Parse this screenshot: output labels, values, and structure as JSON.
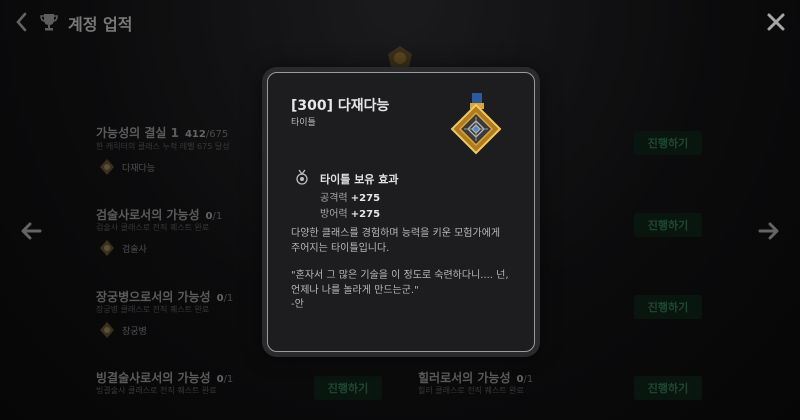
{
  "header": {
    "title": "계정 업적"
  },
  "list": [
    {
      "name": "가능성의 결실 1",
      "done": "412",
      "total": "/675",
      "desc": "한 캐릭터의 클래스 누적 레벨 675 달성",
      "reward": "다재다능",
      "action": "진행하기"
    },
    {
      "name": "검술사로서의 가능성",
      "done": "0",
      "total": "/1",
      "desc": "검술사 클래스로 전직 퀘스트 완료",
      "reward": "검술사",
      "action": "진행하기"
    },
    {
      "name": "장궁병으로서의 가능성",
      "done": "0",
      "total": "/1",
      "desc": "장궁병 클래스로 전직 퀘스트 완료",
      "reward": "장궁병",
      "action": "진행하기"
    },
    {
      "name": "빙결술사로서의 가능성",
      "done": "0",
      "total": "/1",
      "desc": "빙결술사 클래스로 전직 퀘스트 완료",
      "reward": "",
      "action": "진행하기"
    },
    {
      "name": "힐러로서의 가능성",
      "done": "0",
      "total": "/1",
      "desc": "힐러 클래스로 전직 퀘스트 완료",
      "reward": "",
      "action": "진행하기"
    }
  ],
  "modal": {
    "title": "[300] 다재다능",
    "subtitle": "타이틀",
    "effect_title": "타이틀 보유 효과",
    "stats": [
      {
        "label": "공격력",
        "value": "+275"
      },
      {
        "label": "방어력",
        "value": "+275"
      }
    ],
    "desc_lines": [
      "다양한 클래스를 경험하며 능력을 키운 모험가에게",
      "주어지는 타이틀입니다."
    ],
    "quote_lines": [
      "\"혼자서 그 많은 기술을 이 정도로 숙련하다니.... 넌,",
      "언제나 나를 놀라게 만드는군.\"",
      "-안"
    ]
  },
  "colors": {
    "accent_green": "#2f6e4d",
    "medal_gold": "#d9a53a",
    "medal_blue": "#2d5a9a"
  }
}
